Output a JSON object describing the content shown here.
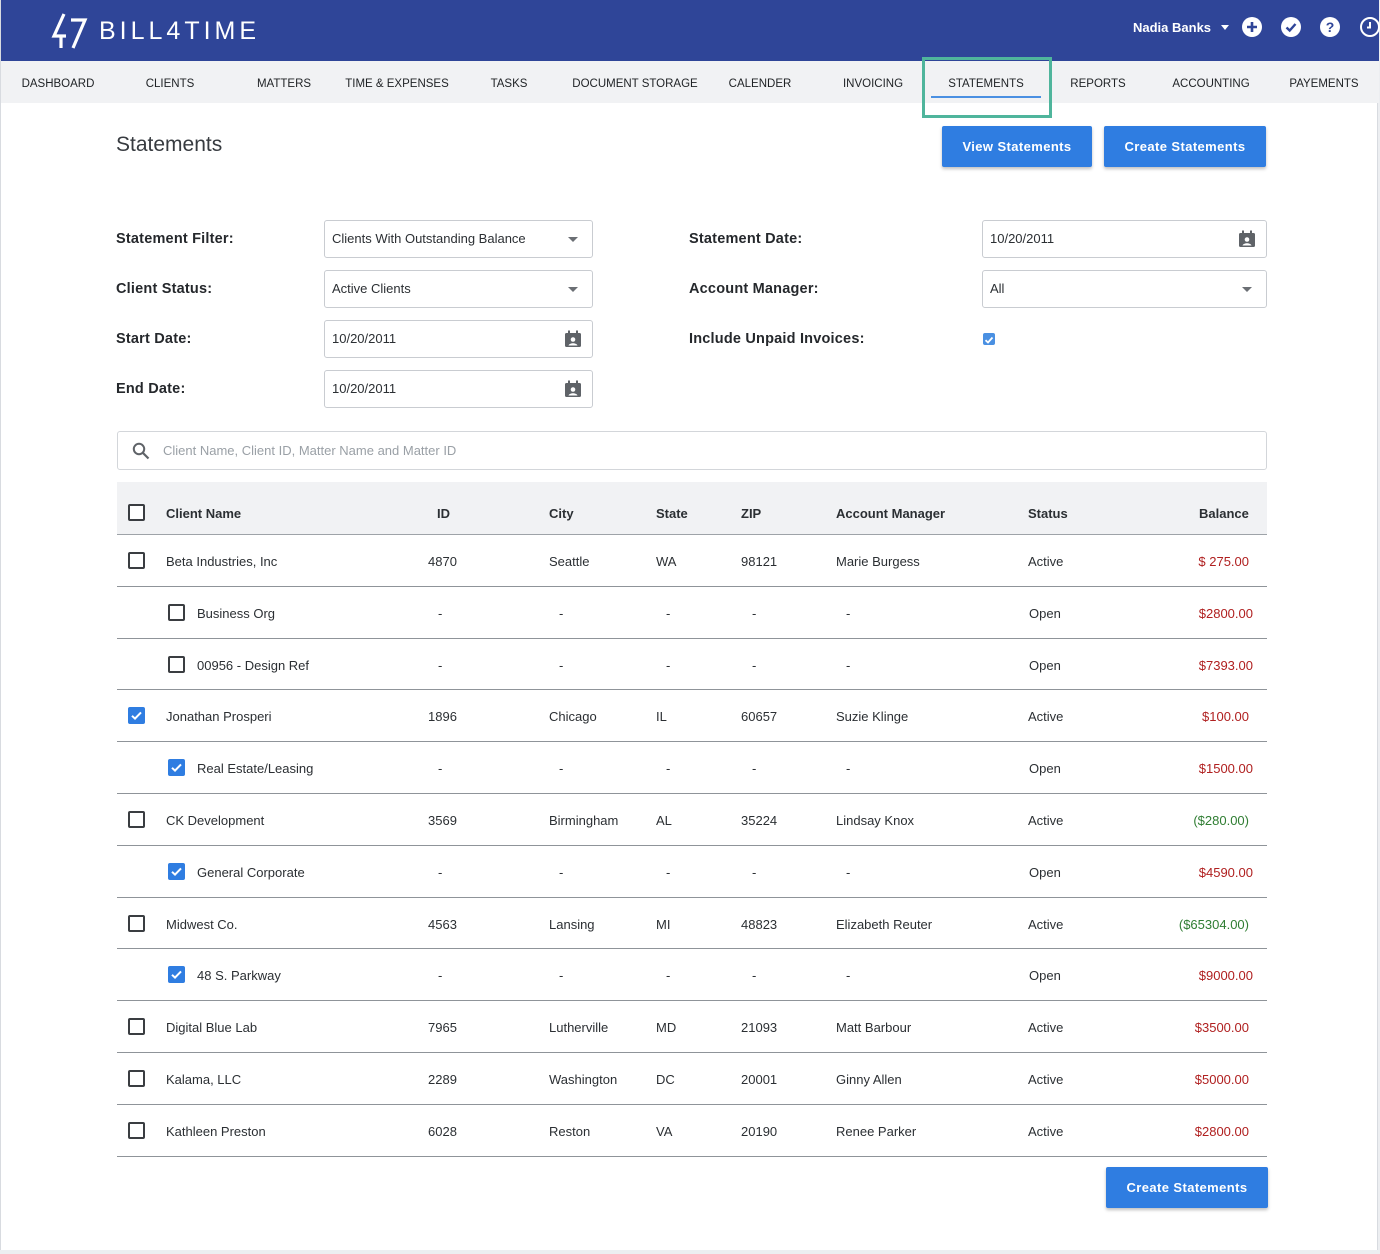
{
  "brand": {
    "name": "BILL4TIME"
  },
  "header": {
    "user_name": "Nadia Banks",
    "icons": [
      "plus-circle-icon",
      "check-circle-icon",
      "help-circle-icon",
      "clock-icon"
    ]
  },
  "nav": {
    "items": [
      {
        "label": "DASHBOARD"
      },
      {
        "label": "CLIENTS"
      },
      {
        "label": "MATTERS"
      },
      {
        "label": "TIME & EXPENSES"
      },
      {
        "label": "TASKS"
      },
      {
        "label": "DOCUMENT STORAGE"
      },
      {
        "label": "CALENDER"
      },
      {
        "label": "INVOICING"
      },
      {
        "label": "STATEMENTS",
        "active": true
      },
      {
        "label": "REPORTS"
      },
      {
        "label": "ACCOUNTING"
      },
      {
        "label": "PAYEMENTS"
      }
    ]
  },
  "page": {
    "title": "Statements",
    "view_button": "View Statements",
    "create_button": "Create Statements",
    "footer_create_button": "Create Statements"
  },
  "filters": {
    "statement_filter": {
      "label": "Statement Filter:",
      "value": "Clients With Outstanding Balance"
    },
    "client_status": {
      "label": "Client Status:",
      "value": "Active Clients"
    },
    "start_date": {
      "label": "Start Date:",
      "value": "10/20/2011"
    },
    "end_date": {
      "label": "End Date:",
      "value": "10/20/2011"
    },
    "statement_date": {
      "label": "Statement Date:",
      "value": "10/20/2011"
    },
    "account_manager": {
      "label": "Account Manager:",
      "value": "All"
    },
    "include_unpaid": {
      "label": "Include Unpaid Invoices:",
      "checked": true
    }
  },
  "search": {
    "placeholder": "Client Name, Client ID, Matter Name and Matter ID"
  },
  "table": {
    "headers": {
      "client_name": "Client Name",
      "id": "ID",
      "city": "City",
      "state": "State",
      "zip": "ZIP",
      "account_manager": "Account Manager",
      "status": "Status",
      "balance": "Balance"
    },
    "rows": [
      {
        "type": "client",
        "checked": false,
        "name": "Beta Industries, Inc",
        "id": "4870",
        "city": "Seattle",
        "state": "WA",
        "zip": "98121",
        "manager": "Marie Burgess",
        "status": "Active",
        "balance": "$ 275.00",
        "tone": "red"
      },
      {
        "type": "matter",
        "checked": false,
        "name": "Business Org",
        "id": "-",
        "city": "-",
        "state": "-",
        "zip": "-",
        "manager": "-",
        "status": "Open",
        "balance": "$2800.00",
        "tone": "red"
      },
      {
        "type": "matter",
        "checked": false,
        "name": "00956 - Design Ref",
        "id": "-",
        "city": "-",
        "state": "-",
        "zip": "-",
        "manager": "-",
        "status": "Open",
        "balance": "$7393.00",
        "tone": "red"
      },
      {
        "type": "client",
        "checked": true,
        "name": "Jonathan Prosperi",
        "id": "1896",
        "city": "Chicago",
        "state": "IL",
        "zip": "60657",
        "manager": "Suzie Klinge",
        "status": "Active",
        "balance": "$100.00",
        "tone": "red"
      },
      {
        "type": "matter",
        "checked": true,
        "name": "Real Estate/Leasing",
        "id": "-",
        "city": "-",
        "state": "-",
        "zip": "-",
        "manager": "-",
        "status": "Open",
        "balance": "$1500.00",
        "tone": "red"
      },
      {
        "type": "client",
        "checked": false,
        "name": "CK Development",
        "id": "3569",
        "city": "Birmingham",
        "state": "AL",
        "zip": "35224",
        "manager": "Lindsay Knox",
        "status": "Active",
        "balance": "($280.00)",
        "tone": "green"
      },
      {
        "type": "matter",
        "checked": true,
        "name": "General Corporate",
        "id": "-",
        "city": "-",
        "state": "-",
        "zip": "-",
        "manager": "-",
        "status": "Open",
        "balance": "$4590.00",
        "tone": "red"
      },
      {
        "type": "client",
        "checked": false,
        "name": "Midwest Co.",
        "id": "4563",
        "city": "Lansing",
        "state": "MI",
        "zip": "48823",
        "manager": "Elizabeth Reuter",
        "status": "Active",
        "balance": "($65304.00)",
        "tone": "green"
      },
      {
        "type": "matter",
        "checked": true,
        "name": "48 S. Parkway",
        "id": "-",
        "city": "-",
        "state": "-",
        "zip": "-",
        "manager": "-",
        "status": "Open",
        "balance": "$9000.00",
        "tone": "red"
      },
      {
        "type": "client",
        "checked": false,
        "name": "Digital Blue Lab",
        "id": "7965",
        "city": "Lutherville",
        "state": "MD",
        "zip": "21093",
        "manager": "Matt Barbour",
        "status": "Active",
        "balance": "$3500.00",
        "tone": "red"
      },
      {
        "type": "client",
        "checked": false,
        "name": "Kalama, LLC",
        "id": "2289",
        "city": "Washington",
        "state": "DC",
        "zip": "20001",
        "manager": "Ginny Allen",
        "status": "Active",
        "balance": "$5000.00",
        "tone": "red"
      },
      {
        "type": "client",
        "checked": false,
        "name": "Kathleen Preston",
        "id": "6028",
        "city": "Reston",
        "state": "VA",
        "zip": "20190",
        "manager": "Renee Parker",
        "status": "Active",
        "balance": "$2800.00",
        "tone": "red"
      }
    ]
  },
  "colors": {
    "header_bg": "#2f4598",
    "primary_button": "#2f7de1",
    "nav_highlight": "#4fb59c",
    "balance_due": "#b02020",
    "balance_credit": "#2f7d32"
  }
}
